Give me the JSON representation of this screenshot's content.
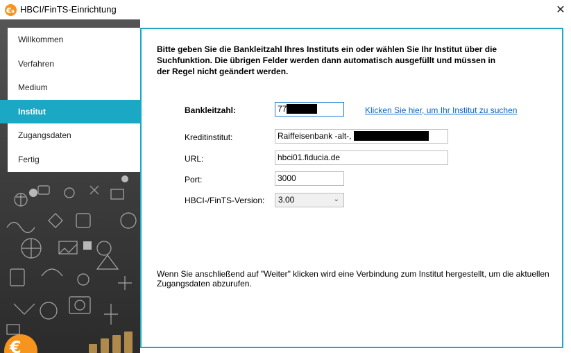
{
  "window": {
    "title": "HBCI/FinTS-Einrichtung",
    "close_glyph": "✕"
  },
  "sidebar": {
    "items": [
      {
        "label": "Willkommen",
        "active": false
      },
      {
        "label": "Verfahren",
        "active": false
      },
      {
        "label": "Medium",
        "active": false
      },
      {
        "label": "Institut",
        "active": true
      },
      {
        "label": "Zugangsdaten",
        "active": false
      },
      {
        "label": "Fertig",
        "active": false
      }
    ]
  },
  "main": {
    "intro": "Bitte geben Sie die Bankleitzahl Ihres Instituts ein oder wählen Sie Ihr Institut über die Suchfunktion. Die übrigen Felder werden dann automatisch ausgefüllt und müssen in der Regel nicht geändert werden.",
    "bankleitzahl": {
      "label": "Bankleitzahl:",
      "value": "77"
    },
    "search_link": "Klicken Sie hier, um Ihr Institut zu suchen",
    "kreditinstitut": {
      "label": "Kreditinstitut:",
      "value": "Raiffeisenbank -alt-,"
    },
    "url": {
      "label": "URL:",
      "value": "hbci01.fiducia.de"
    },
    "port": {
      "label": "Port:",
      "value": "3000"
    },
    "version": {
      "label": "HBCI-/FinTS-Version:",
      "value": "3.00"
    },
    "footer": "Wenn Sie anschließend auf \"Weiter\" klicken wird eine Verbindung zum Institut hergestellt, um die aktuellen Zugangsdaten abzurufen."
  },
  "colors": {
    "accent": "#1ba8c4",
    "link": "#0b63c7",
    "logo": "#f7941d"
  },
  "icons": {
    "app_logo": "euro-logo-icon",
    "close": "close-icon",
    "dropdown": "chevron-down-icon"
  }
}
